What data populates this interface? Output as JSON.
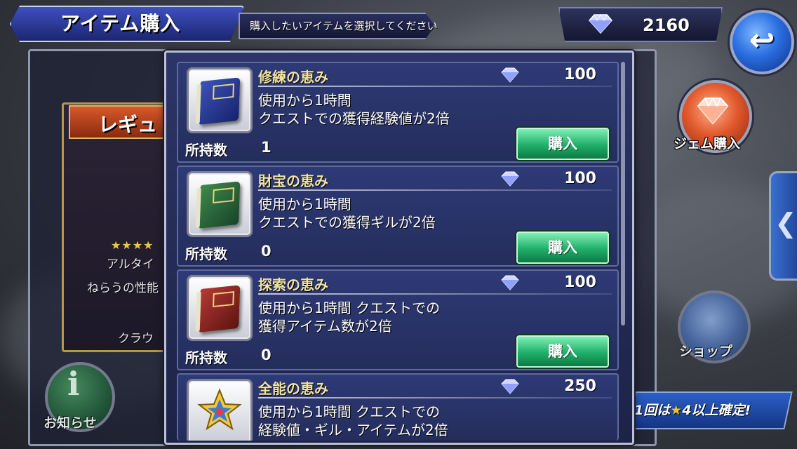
{
  "header": {
    "title": "アイテム購入",
    "subtitle": "購入したいアイテムを選択してください",
    "gem_count": "2160",
    "back_icon": "back-arrow-icon"
  },
  "background": {
    "card_title": "レギュ",
    "card_line_1": "アルタイ",
    "card_line_2": "ねらうの性能",
    "card_line_3": "クラウ",
    "info_label": "お知らせ"
  },
  "side": {
    "gem_shop_label": "ジェム購入",
    "shop_label": "ショップ",
    "tab_arrow": "❮",
    "gacha_prefix": "1回は",
    "gacha_suffix": "4以上確定!"
  },
  "items": [
    {
      "name": "修練の恵み",
      "price": "100",
      "desc_line_1": "使用から1時間",
      "desc_line_2": "クエストでの獲得経験値が2倍",
      "owned_label": "所持数",
      "owned": "1",
      "buy_label": "購入",
      "icon": "blue-book-icon"
    },
    {
      "name": "財宝の恵み",
      "price": "100",
      "desc_line_1": "使用から1時間",
      "desc_line_2": "クエストでの獲得ギルが2倍",
      "owned_label": "所持数",
      "owned": "0",
      "buy_label": "購入",
      "icon": "green-book-icon"
    },
    {
      "name": "探索の恵み",
      "price": "100",
      "desc_line_1": "使用から1時間 クエストでの",
      "desc_line_2": "獲得アイテム数が2倍",
      "owned_label": "所持数",
      "owned": "0",
      "buy_label": "購入",
      "icon": "red-book-icon"
    },
    {
      "name": "全能の恵み",
      "price": "250",
      "desc_line_1": "使用から1時間 クエストでの",
      "desc_line_2": "経験値・ギル・アイテムが2倍",
      "icon": "star-emblem-icon"
    }
  ],
  "colors": {
    "dialog_bg": "#242d5c",
    "buy_button": "#1fae6a",
    "item_name": "#f0e4a4",
    "header_banner": "#3e4fc0"
  }
}
